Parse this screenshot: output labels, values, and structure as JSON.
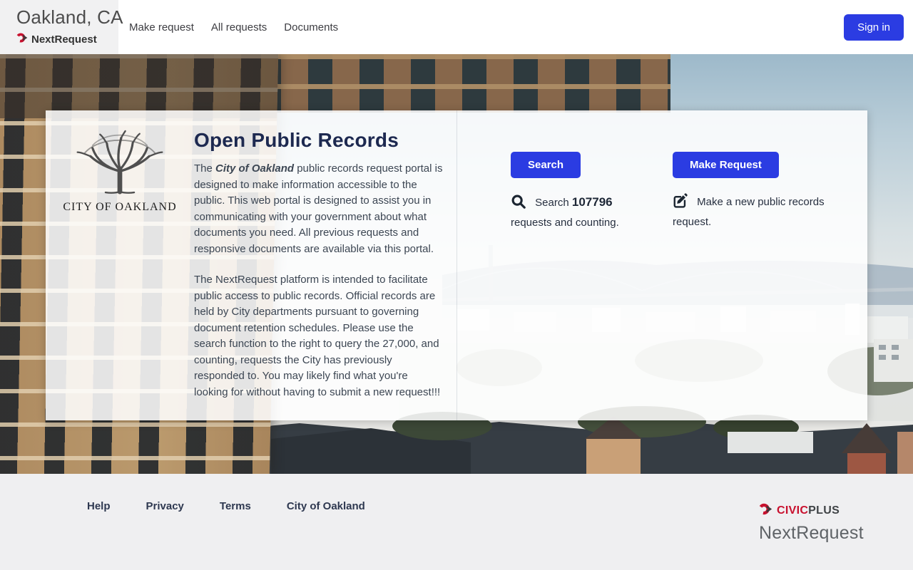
{
  "header": {
    "site_name": "Oakland, CA",
    "brand": "NextRequest",
    "nav": [
      {
        "label": "Make request"
      },
      {
        "label": "All requests"
      },
      {
        "label": "Documents"
      }
    ],
    "sign_in_label": "Sign in"
  },
  "hero": {
    "logo_caption": "CITY OF OAKLAND",
    "title": "Open Public Records",
    "intro_pre": "The ",
    "intro_bold": "City of Oakland",
    "intro_post": " public records request portal is designed to make information accessible to the public.  This web portal is designed to assist you in communicating with your government about what documents you need. All previous requests and responsive documents are available via this portal.",
    "paragraph2": "The NextRequest platform is intended to facilitate public access to public records. Official records are held by City departments pursuant to governing document retention schedules. Please use the search function to the right to query the 27,000, and counting, requests the City has previously responded to. You may likely find what you're looking for without having to submit a new request!!!",
    "search": {
      "button_label": "Search",
      "desc_pre": "Search ",
      "count": "107796",
      "desc_post": " requests and counting."
    },
    "request": {
      "button_label": "Make Request",
      "desc": "Make a new public records request."
    }
  },
  "footer": {
    "links": [
      "Help",
      "Privacy",
      "Terms",
      "City of Oakland"
    ],
    "civic_word": "CIVIC",
    "plus_word": "PLUS",
    "brand_wordmark": "NextRequest"
  },
  "colors": {
    "accent_blue": "#2b3ce2",
    "civicplus_red": "#c8102e",
    "heading_navy": "#1d2950",
    "footer_bg": "#efeff1"
  }
}
